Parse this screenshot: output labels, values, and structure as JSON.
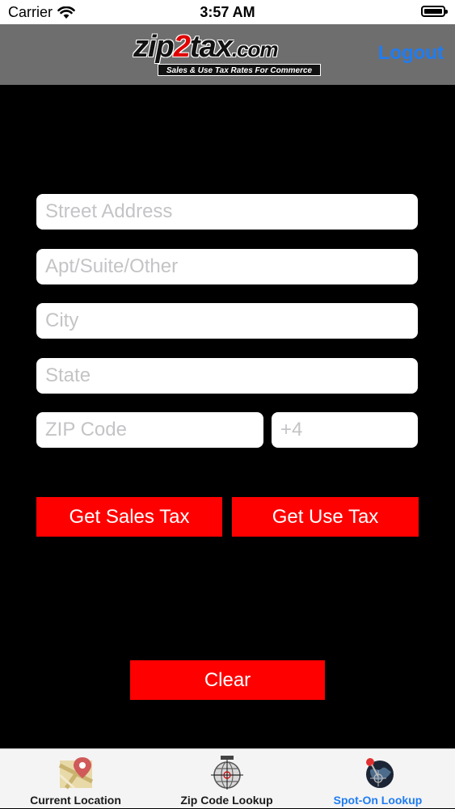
{
  "status_bar": {
    "carrier": "Carrier",
    "time": "3:57 AM"
  },
  "header": {
    "logo_text_a": "zip",
    "logo_text_b": "2",
    "logo_text_c": "tax",
    "logo_dotcom": ".com",
    "logo_tagline": "Sales & Use Tax Rates For Commerce",
    "logout_label": "Logout"
  },
  "form": {
    "street_placeholder": "Street Address",
    "apt_placeholder": "Apt/Suite/Other",
    "city_placeholder": "City",
    "state_placeholder": "State",
    "zip_placeholder": "ZIP Code",
    "plus4_placeholder": "+4",
    "sales_tax_label": "Get Sales Tax",
    "use_tax_label": "Get Use Tax",
    "clear_label": "Clear"
  },
  "tab_bar": {
    "tabs": [
      {
        "label": "Current Location",
        "icon": "map-pin-icon",
        "active": false
      },
      {
        "label": "Zip Code Lookup",
        "icon": "zip-globe-icon",
        "active": false
      },
      {
        "label": "Spot-On Lookup",
        "icon": "spot-on-globe-icon",
        "active": true
      }
    ]
  },
  "colors": {
    "background": "#000000",
    "header_bg": "#6e6e6e",
    "accent_red": "#ff0000",
    "link_blue": "#1f7cf2",
    "tab_bar_bg": "#f4f4f4"
  }
}
